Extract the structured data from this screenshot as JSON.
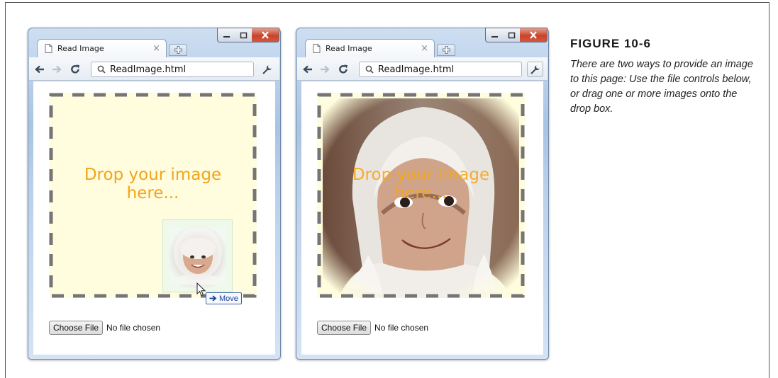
{
  "browser_windows": [
    {
      "tab_title": "Read Image",
      "address": "ReadImage.html",
      "drop_text": "Drop your image here...",
      "choose_file_label": "Choose File",
      "file_status": "No file chosen",
      "drag_badge": "Move"
    },
    {
      "tab_title": "Read Image",
      "address": "ReadImage.html",
      "drop_text": "Drop your image here...",
      "choose_file_label": "Choose File",
      "file_status": "No file chosen"
    }
  ],
  "figure": {
    "label": "FIGURE 10-6",
    "caption": "There are two ways to provide an image to this page: Use the file controls below, or drag one or more images onto the drop box."
  },
  "colors": {
    "drop_text": "#f2a41a",
    "drop_background": "#fffdde",
    "dash_border": "#757575",
    "window_frame": "#6f8aa8",
    "close_button": "#c7442c"
  },
  "icons": [
    "page-icon",
    "close-tab-icon",
    "new-tab-icon",
    "back-arrow-icon",
    "forward-arrow-icon",
    "reload-icon",
    "search-icon",
    "wrench-icon",
    "minimize-icon",
    "maximize-icon",
    "close-window-icon",
    "cursor-icon",
    "move-arrow-icon"
  ]
}
